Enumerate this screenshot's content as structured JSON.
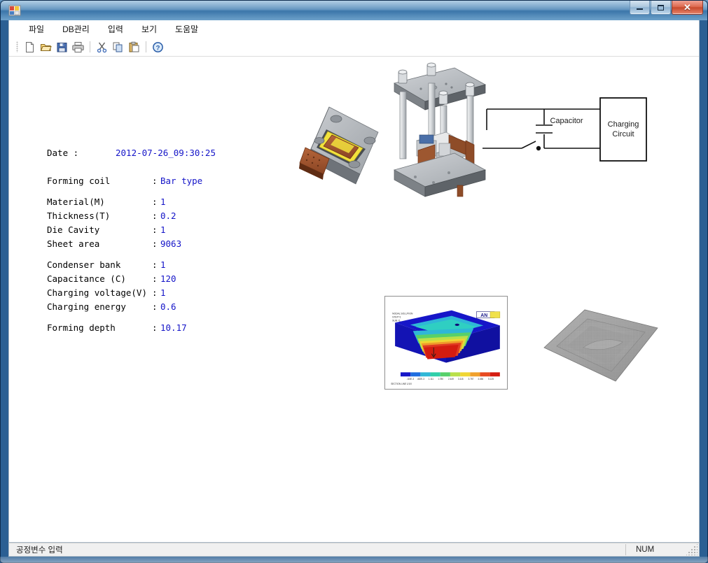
{
  "window": {
    "title": "",
    "caption_buttons": [
      {
        "name": "minimize",
        "glyph": ""
      },
      {
        "name": "maximize",
        "glyph": ""
      },
      {
        "name": "close",
        "glyph": "✕"
      }
    ]
  },
  "menu": {
    "items": [
      {
        "id": "file",
        "label": "파일"
      },
      {
        "id": "db",
        "label": "DB관리"
      },
      {
        "id": "input",
        "label": "입력"
      },
      {
        "id": "view",
        "label": "보기"
      },
      {
        "id": "help",
        "label": "도움말"
      }
    ]
  },
  "toolbar": {
    "buttons": [
      {
        "id": "new",
        "icon": "new-document-icon"
      },
      {
        "id": "open",
        "icon": "open-folder-icon"
      },
      {
        "id": "save",
        "icon": "save-disk-icon"
      },
      {
        "id": "print",
        "icon": "printer-icon"
      },
      {
        "id": "cut",
        "icon": "scissors-icon"
      },
      {
        "id": "copy",
        "icon": "copy-icon"
      },
      {
        "id": "paste",
        "icon": "paste-icon"
      },
      {
        "id": "help",
        "icon": "help-question-icon"
      }
    ]
  },
  "report": {
    "date": {
      "label": "Date :",
      "value": "2012-07-26_09:30:25"
    },
    "rows": [
      {
        "label": "Forming coil",
        "colon": ":",
        "value": "Bar type"
      },
      {
        "label": "Material(M)",
        "colon": ":",
        "value": "1"
      },
      {
        "label": "Thickness(T)",
        "colon": ":",
        "value": "0.2"
      },
      {
        "label": "Die Cavity",
        "colon": ":",
        "value": "1"
      },
      {
        "label": "Sheet area",
        "colon": ":",
        "value": "9063"
      },
      {
        "label": "Condenser bank",
        "colon": ":",
        "value": "1"
      },
      {
        "label": "Capacitance (C)",
        "colon": ":",
        "value": "120"
      },
      {
        "label": "Charging voltage(V)",
        "colon": ":",
        "value": "1"
      },
      {
        "label": "Charging energy",
        "colon": ":",
        "value": "0.6"
      },
      {
        "label": "Forming depth",
        "colon": ":",
        "value": "10.17"
      }
    ],
    "figures": {
      "die_model": {
        "name": "die-cad-model"
      },
      "press": {
        "name": "press-machine-cad-model"
      },
      "mesh_part": {
        "name": "meshed-formed-part"
      },
      "fea": {
        "name": "fea-contour-plot",
        "watermark": "AN",
        "header_lines": [
          "NODAL SOLUTION",
          "STEP=1",
          "SUB =1"
        ],
        "footer_text": "SECTION LINE 1/1/0",
        "legend_ticks": [
          ".115E-3",
          ".482E-3",
          "1.111",
          "1.780",
          "2.449",
          "3.118",
          "3.787",
          "4.456",
          "5.125"
        ]
      }
    },
    "circuit": {
      "capacitor_label": "Capacitor",
      "charging_box_lines": [
        "Charging",
        "Circuit"
      ]
    }
  },
  "statusbar": {
    "message": "공정변수 입력",
    "num_indicator": "NUM"
  },
  "colors": {
    "value_blue": "#1414c8",
    "label_black": "#000000",
    "frame_blue": "#2b5f93",
    "close_red": "#c74a2d"
  }
}
